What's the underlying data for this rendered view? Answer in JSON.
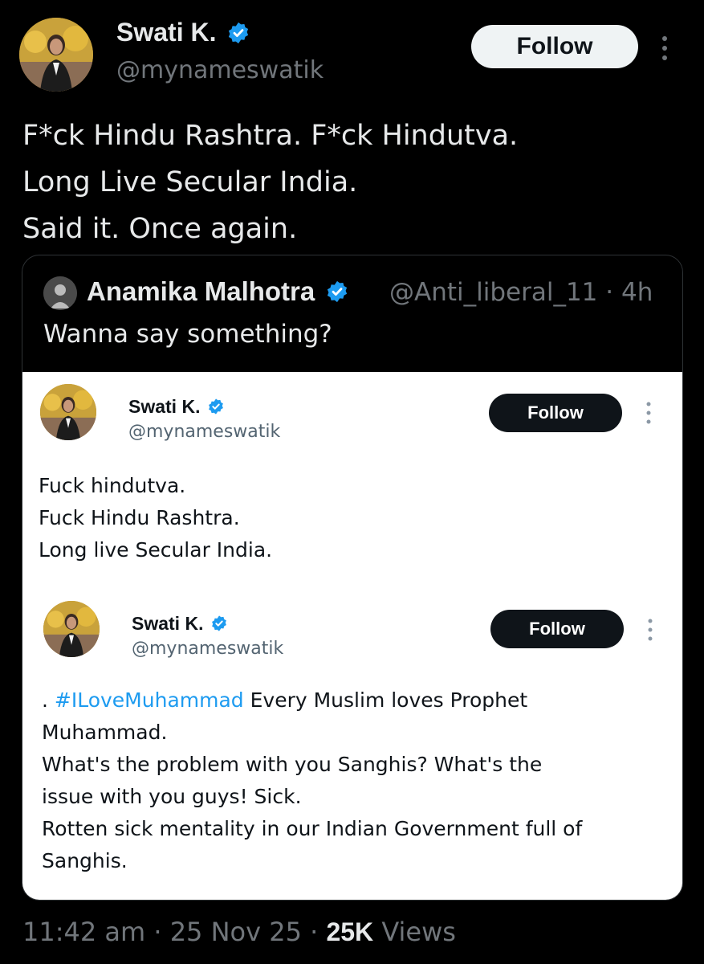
{
  "author": {
    "name": "Swati K.",
    "handle": "@mynameswatik",
    "verified_color": "#1d9bf0",
    "follow_label": "Follow"
  },
  "tweet": {
    "lines": [
      "F*ck Hindu Rashtra. F*ck Hindutva.",
      "Long Live Secular India.",
      "Said it. Once again."
    ]
  },
  "quote": {
    "name": "Anamika Malhotra",
    "handle": "@Anti_liberal_11",
    "separator": "·",
    "time": "4h",
    "text": "Wanna say something?",
    "embedded_posts": [
      {
        "name": "Swati K.",
        "handle": "@mynameswatik",
        "follow_label": "Follow",
        "lines": [
          "Fuck hindutva.",
          "Fuck Hindu Rashtra.",
          "Long live Secular India."
        ]
      },
      {
        "name": "Swati K.",
        "handle": "@mynameswatik",
        "follow_label": "Follow",
        "prefix": ". ",
        "hashtag": "#ILoveMuhammad",
        "first_line_rest": " Every Muslim loves Prophet",
        "lines": [
          "Muhammad.",
          "What's the problem with you Sanghis? What's the",
          "issue with you guys! Sick.",
          "Rotten sick mentality in our Indian Government full of",
          "Sanghis."
        ]
      }
    ]
  },
  "footer": {
    "time": "11:42 am",
    "sep1": " · ",
    "date": "25 Nov 25",
    "sep2": " · ",
    "views_count": "25K",
    "views_label": " Views"
  },
  "colors": {
    "background": "#000000",
    "text": "#e7e9ea",
    "muted": "#71767b",
    "accent": "#1d9bf0"
  }
}
